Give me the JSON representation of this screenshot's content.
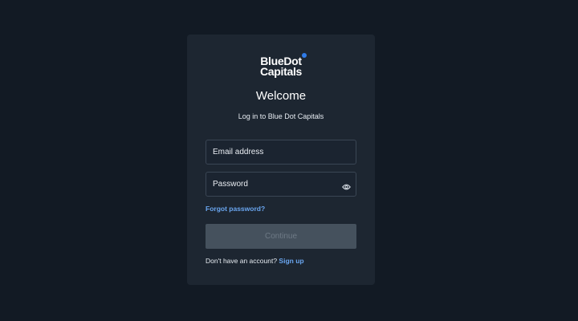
{
  "brand": {
    "name_line1": "BlueDot",
    "name_line2": "Capitals",
    "accent_color": "#2f7be8"
  },
  "login": {
    "title": "Welcome",
    "subtitle": "Log in to Blue Dot Capitals",
    "email_placeholder": "Email address",
    "password_placeholder": "Password",
    "password_toggle_icon": "eye-icon",
    "forgot_password": "Forgot password?",
    "continue_label": "Continue",
    "signup_prompt": "Don't have an account?",
    "signup_label": "Sign up",
    "link_color": "#6aa6f0"
  }
}
